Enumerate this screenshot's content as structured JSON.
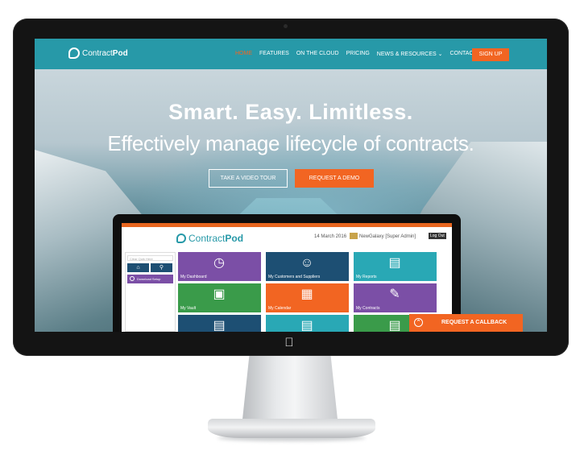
{
  "nav": {
    "logo_prefix": "Contract",
    "logo_bold": "Pod",
    "links": [
      "HOME",
      "FEATURES",
      "ON THE CLOUD",
      "PRICING",
      "NEWS & RESOURCES ⌄",
      "CONTACT US"
    ],
    "active": "HOME",
    "signup": "SIGN UP"
  },
  "hero": {
    "title": "Smart. Easy. Limitless.",
    "subtitle": "Effectively manage lifecycle of contracts.",
    "tour_button": "TAKE A VIDEO TOUR",
    "demo_button": "REQUEST A DEMO"
  },
  "app": {
    "logo_prefix": "Contract",
    "logo_bold": "Pod",
    "date": "14 March 2016",
    "user": "NewGalaxy   [Super Admin]",
    "logout": "Log Out",
    "search_placeholder": "Clear Quik Here",
    "download": "Download Setup",
    "tiles": [
      {
        "label": "My Dashboard",
        "color": "#7b4fa6",
        "icon": "speedometer-icon"
      },
      {
        "label": "My Customers and Suppliers",
        "color": "#1d4f73",
        "icon": "people-icon"
      },
      {
        "label": "My Reports",
        "color": "#29a8b5",
        "icon": "report-icon"
      },
      {
        "label": "My Vault",
        "color": "#3a9b4a",
        "icon": "vault-icon"
      },
      {
        "label": "My Calendar",
        "color": "#f26522",
        "icon": "calendar-icon"
      },
      {
        "label": "My Contracts",
        "color": "#7b4fa6",
        "icon": "contract-icon"
      },
      {
        "label": "",
        "color": "#1d4f73",
        "icon": "document-icon"
      },
      {
        "label": "",
        "color": "#29a8b5",
        "icon": "document-icon"
      },
      {
        "label": "",
        "color": "#3a9b4a",
        "icon": "document-icon"
      }
    ]
  },
  "callback": {
    "label": "REQUEST A CALLBACK"
  },
  "colors": {
    "brand": "#2799a8",
    "accent": "#f26522"
  }
}
